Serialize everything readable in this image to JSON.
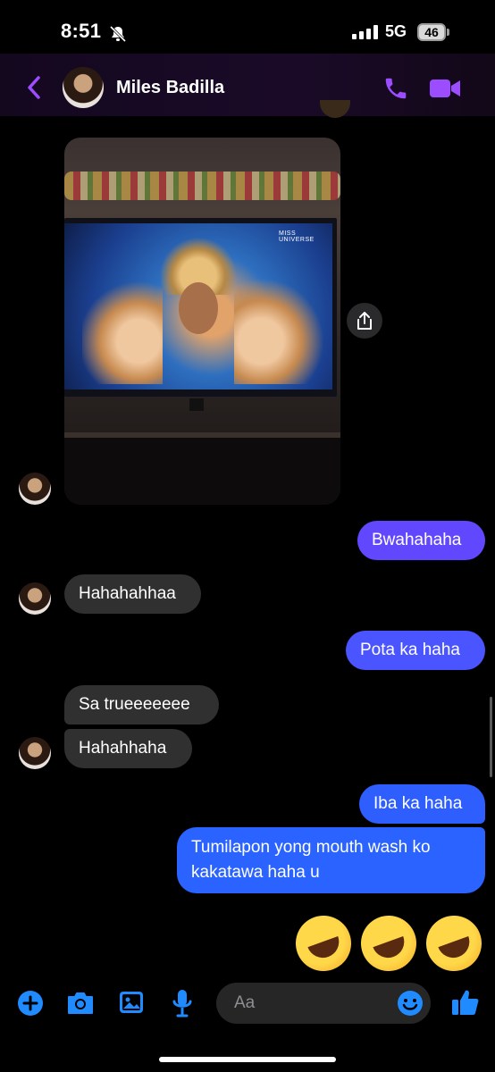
{
  "status_bar": {
    "time": "8:51",
    "network": "5G",
    "battery": "46"
  },
  "header": {
    "contact_name": "Miles Badilla"
  },
  "messages": [
    {
      "from": "them",
      "type": "photo"
    },
    {
      "from": "me",
      "text": "Bwahahaha"
    },
    {
      "from": "them",
      "text": "Hahahahhaa"
    },
    {
      "from": "me",
      "text": "Pota ka haha"
    },
    {
      "from": "them",
      "text": "Sa trueeeeeee"
    },
    {
      "from": "them",
      "text": "Hahahhaha"
    },
    {
      "from": "me",
      "text": "Iba ka haha"
    },
    {
      "from": "me",
      "text_line1": "Tumilapon yong mouth wash ko",
      "text_line2": "kakatawa haha u"
    }
  ],
  "photo": {
    "tv_logo": "MISS UNIVERSE"
  },
  "emoji_reaction": {
    "icon": "rolling-on-floor-laughing",
    "count": 3
  },
  "composer": {
    "placeholder": "Aa"
  },
  "colors": {
    "accent": "#9b4dff",
    "sent_top": "#6b4bff",
    "sent_bottom": "#2d6bff",
    "received": "#303030",
    "icon_blue": "#1f8bff"
  }
}
